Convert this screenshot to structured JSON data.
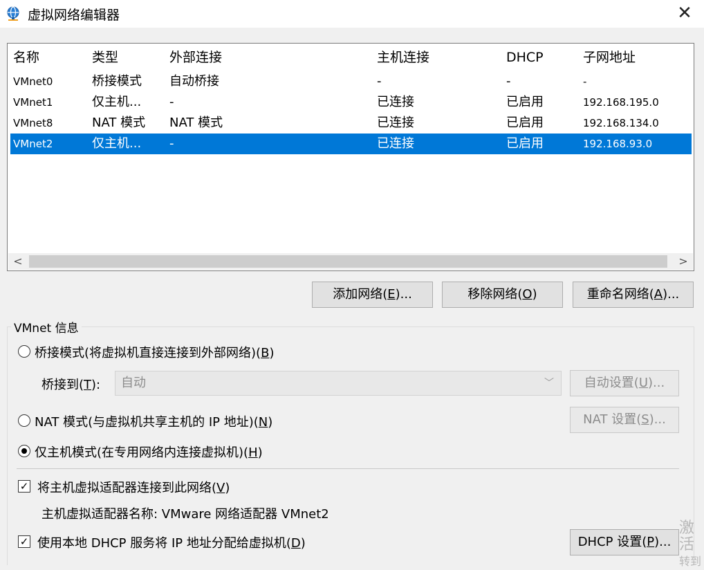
{
  "window": {
    "title": "虚拟网络编辑器",
    "icon": "network-globe-icon",
    "close_glyph": "✕"
  },
  "table": {
    "headers": [
      "名称",
      "类型",
      "外部连接",
      "主机连接",
      "DHCP",
      "子网地址"
    ],
    "rows": [
      [
        "VMnet0",
        "桥接模式",
        "自动桥接",
        "-",
        "-",
        "-"
      ],
      [
        "VMnet1",
        "仅主机...",
        "-",
        "已连接",
        "已启用",
        "192.168.195.0"
      ],
      [
        "VMnet8",
        "NAT 模式",
        "NAT 模式",
        "已连接",
        "已启用",
        "192.168.134.0"
      ],
      [
        "VMnet2",
        "仅主机...",
        "-",
        "已连接",
        "已启用",
        "192.168.93.0"
      ]
    ],
    "selected_row": 3,
    "scroll_left": "<",
    "scroll_right": ">"
  },
  "actions": {
    "add": {
      "pre": "添加网络(",
      "key": "E",
      "post": ")..."
    },
    "remove": {
      "pre": "移除网络(",
      "key": "O",
      "post": ")"
    },
    "rename": {
      "pre": "重命名网络(",
      "key": "A",
      "post": ")..."
    }
  },
  "info": {
    "group_title": "VMnet 信息",
    "bridge": {
      "pre": "桥接模式(将虚拟机直接连接到外部网络)(",
      "key": "B",
      "post": ")"
    },
    "bridge_to": {
      "pre": "桥接到(",
      "key": "T",
      "post": "):"
    },
    "bridge_to_value": "自动",
    "auto_settings": {
      "pre": "自动设置(",
      "key": "U",
      "post": ")..."
    },
    "nat": {
      "pre": "NAT 模式(与虚拟机共享主机的 IP 地址)(",
      "key": "N",
      "post": ")"
    },
    "nat_settings": {
      "pre": "NAT 设置(",
      "key": "S",
      "post": ")..."
    },
    "hostonly": {
      "pre": "仅主机模式(在专用网络内连接虚拟机)(",
      "key": "H",
      "post": ")"
    },
    "selected_mode": "hostonly",
    "connect_adapter": {
      "pre": "将主机虚拟适配器连接到此网络(",
      "key": "V",
      "post": ")"
    },
    "connect_adapter_checked": true,
    "adapter_name": "主机虚拟适配器名称: VMware 网络适配器 VMnet2",
    "use_dhcp": {
      "pre": "使用本地 DHCP 服务将 IP 地址分配给虚拟机(",
      "key": "D",
      "post": ")"
    },
    "use_dhcp_checked": true,
    "dhcp_settings": {
      "pre": "DHCP 设置(",
      "key": "P",
      "post": ")..."
    }
  },
  "watermark": {
    "line1": "激活",
    "line2": "转到"
  },
  "colors": {
    "selection": "#0078d7",
    "window_bg": "#f0f0f0"
  }
}
